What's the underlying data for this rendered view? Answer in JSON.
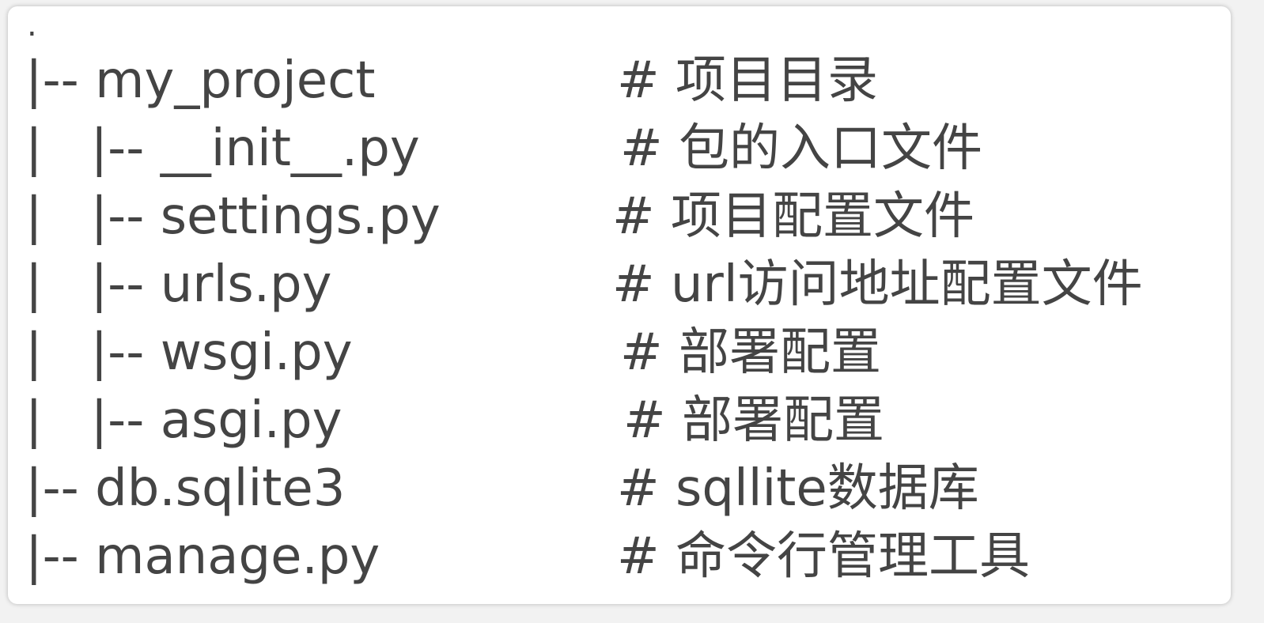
{
  "root": ".",
  "lines": [
    {
      "path": "|-- my_project",
      "comment": "# 项目目录"
    },
    {
      "path": "|   |-- __init__.py",
      "comment": "# 包的入口文件"
    },
    {
      "path": "|   |-- settings.py",
      "comment": "# 项目配置文件"
    },
    {
      "path": "|   |-- urls.py",
      "comment": "# url访问地址配置文件"
    },
    {
      "path": "|   |-- wsgi.py",
      "comment": "# 部署配置"
    },
    {
      "path": "|   |-- asgi.py",
      "comment": "# 部署配置"
    },
    {
      "path": "|-- db.sqlite3",
      "comment": "# sqllite数据库"
    },
    {
      "path": "|-- manage.py",
      "comment": "# 命令行管理工具"
    }
  ]
}
